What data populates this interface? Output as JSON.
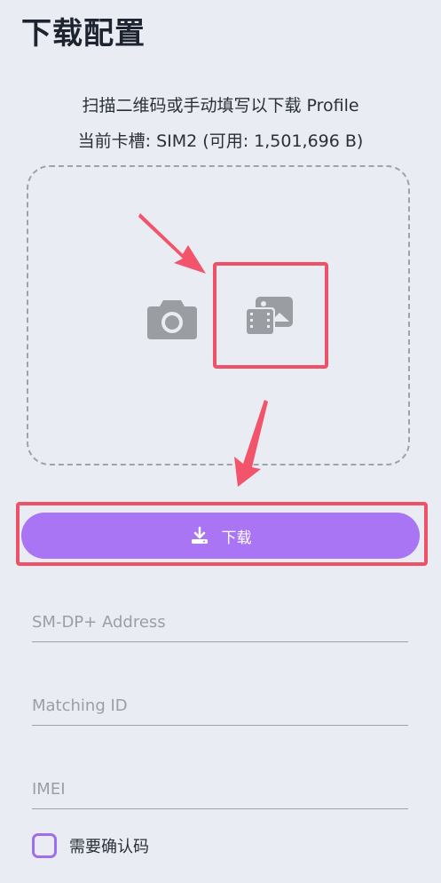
{
  "header": {
    "title": "下载配置"
  },
  "instructions": {
    "line1": "扫描二维码或手动填写以下载 Profile",
    "line2": "当前卡槽: SIM2 (可用: 1,501,696 B)"
  },
  "scan": {
    "camera_icon": "camera-icon",
    "gallery_icon": "gallery-icon"
  },
  "download": {
    "label": "下载",
    "icon": "download-icon"
  },
  "form": {
    "smdp_placeholder": "SM-DP+ Address",
    "smdp_value": "",
    "matching_id_placeholder": "Matching ID",
    "matching_id_value": "",
    "imei_placeholder": "IMEI",
    "imei_value": "",
    "confirm_code_label": "需要确认码",
    "confirm_code_checked": false
  },
  "colors": {
    "background": "#e9ecf2",
    "accent": "#a975f4",
    "highlight": "#ef5267",
    "icon_gray": "#9a9da1"
  }
}
